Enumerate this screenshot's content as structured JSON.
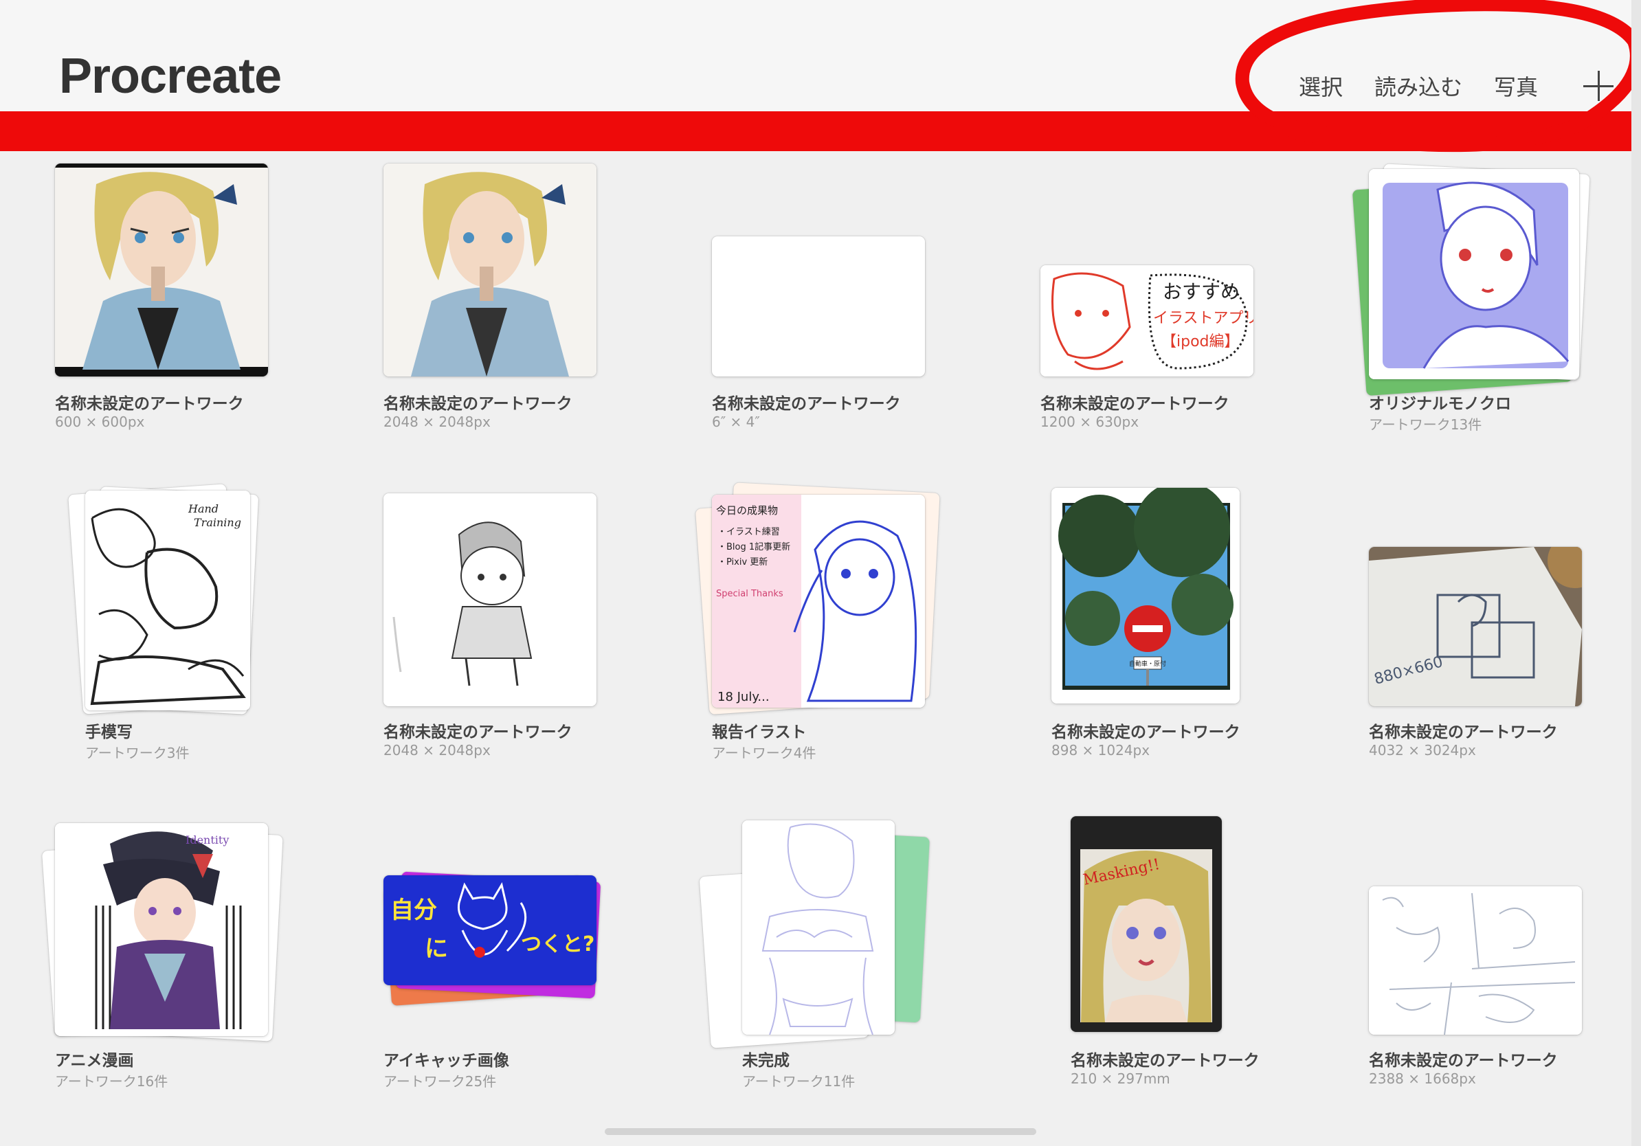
{
  "app": {
    "title": "Procreate"
  },
  "toolbar": {
    "select": "選択",
    "import": "読み込む",
    "photo": "写真",
    "add_icon": "plus-icon"
  },
  "annotation": {
    "color": "#ee0a0a"
  },
  "gallery": {
    "items": [
      {
        "title": "名称未設定のアートワーク",
        "sub": "600 × 600px"
      },
      {
        "title": "名称未設定のアートワーク",
        "sub": "2048 × 2048px"
      },
      {
        "title": "名称未設定のアートワーク",
        "sub": "6″ × 4″"
      },
      {
        "title": "名称未設定のアートワーク",
        "sub": "1200 × 630px",
        "thumb_text": [
          "おすすめ",
          "イラストアプリ",
          "【ipod編】"
        ]
      },
      {
        "title": "オリジナルモノクロ",
        "sub": "アートワーク13件"
      },
      {
        "title": "手模写",
        "sub": "アートワーク3件",
        "thumb_text": [
          "Hand",
          "Training"
        ]
      },
      {
        "title": "名称未設定のアートワーク",
        "sub": "2048 × 2048px"
      },
      {
        "title": "報告イラスト",
        "sub": "アートワーク4件",
        "thumb_text": [
          "今日の成果物",
          "・イラスト練習",
          "・Blog 1記事更新",
          "・Pixiv 更新",
          "Special Thanks",
          "18 July..."
        ]
      },
      {
        "title": "名称未設定のアートワーク",
        "sub": "898 × 1024px",
        "thumb_text": [
          "自動車・原付"
        ]
      },
      {
        "title": "名称未設定のアートワーク",
        "sub": "4032 × 3024px",
        "thumb_text": [
          "880×660"
        ]
      },
      {
        "title": "アニメ漫画",
        "sub": "アートワーク16件",
        "thumb_text": [
          "Identity"
        ]
      },
      {
        "title": "アイキャッチ画像",
        "sub": "アートワーク25件",
        "thumb_text": [
          "自分",
          "に",
          "つくと?"
        ]
      },
      {
        "title": "未完成",
        "sub": "アートワーク11件"
      },
      {
        "title": "名称未設定のアートワーク",
        "sub": "210 × 297mm",
        "thumb_text": [
          "Masking!!"
        ]
      },
      {
        "title": "名称未設定のアートワーク",
        "sub": "2388 × 1668px"
      }
    ]
  }
}
